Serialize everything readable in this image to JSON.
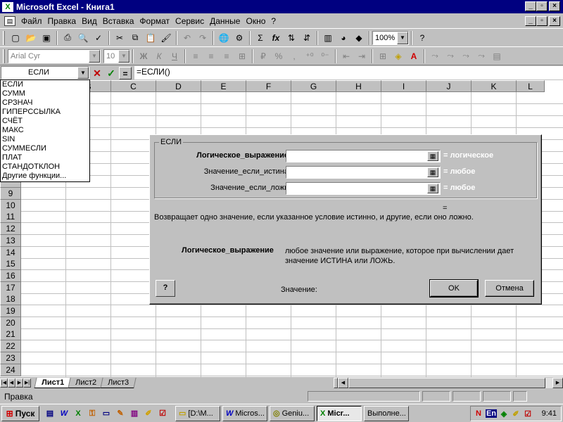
{
  "window": {
    "title": "Microsoft Excel - Книга1"
  },
  "menu": [
    {
      "label": "Файл"
    },
    {
      "label": "Правка"
    },
    {
      "label": "Вид"
    },
    {
      "label": "Вставка"
    },
    {
      "label": "Формат"
    },
    {
      "label": "Сервис"
    },
    {
      "label": "Данные"
    },
    {
      "label": "Окно"
    },
    {
      "label": "?"
    }
  ],
  "toolbar_standard": {
    "zoom": "100%",
    "sigma": "Σ",
    "fx": "fx"
  },
  "toolbar_format": {
    "font": "Arial Cyr",
    "size": "10",
    "bold": "Ж",
    "italic": "К",
    "underline": "Ч",
    "percent": "%"
  },
  "formula_bar": {
    "name_box": "ЕСЛИ",
    "formula": "=ЕСЛИ()",
    "cancel": "✕",
    "enter": "✓",
    "equals": "="
  },
  "grid": {
    "columns": [
      "B",
      "C",
      "D",
      "E",
      "F",
      "G",
      "H",
      "I",
      "J",
      "K",
      "L"
    ],
    "rows": [
      "9",
      "10",
      "11",
      "12",
      "13",
      "14",
      "15",
      "16",
      "17",
      "18",
      "19",
      "20",
      "21",
      "22",
      "23",
      "24"
    ]
  },
  "function_list": [
    "ЕСЛИ",
    "СУММ",
    "СРЗНАЧ",
    "ГИПЕРССЫЛКА",
    "СЧЁТ",
    "МАКС",
    "SIN",
    "СУММЕСЛИ",
    "ПЛАТ",
    "СТАНДОТКЛОН",
    "Другие функции..."
  ],
  "dialog": {
    "group_title": "ЕСЛИ",
    "args": [
      {
        "label": "Логическое_выражение",
        "result": "логическое",
        "bold": true
      },
      {
        "label": "Значение_если_истина",
        "result": "любое",
        "bold": false
      },
      {
        "label": "Значение_если_ложь",
        "result": "любое",
        "bold": false
      }
    ],
    "equals": "=",
    "description": "Возвращает одно значение, если указанное условие истинно, и другие, если оно ложно.",
    "arg_title": "Логическое_выражение",
    "arg_description": "любое значение или выражение, которое при вычислении дает значение ИСТИНА или ЛОЖЬ.",
    "value_label": "Значение:",
    "ok": "OK",
    "cancel": "Отмена",
    "help": "?"
  },
  "sheets": [
    {
      "label": "Лист1",
      "active": true
    },
    {
      "label": "Лист2",
      "active": false
    },
    {
      "label": "Лист3",
      "active": false
    }
  ],
  "status": "Правка",
  "taskbar": {
    "start": "Пуск",
    "tasks": [
      {
        "label": "[D:\\M...",
        "icon": "folder",
        "active": false
      },
      {
        "label": "Micros...",
        "icon": "word",
        "active": false
      },
      {
        "label": "Geniu...",
        "icon": "app",
        "active": false
      },
      {
        "label": "Micr...",
        "icon": "excel",
        "active": true
      },
      {
        "label": "Выполне...",
        "icon": "none",
        "active": false
      }
    ],
    "language": "En",
    "time": "9:41"
  },
  "colors": {
    "titlebar": "#000080",
    "face": "#c0c0c0",
    "excel_green": "#008000"
  }
}
